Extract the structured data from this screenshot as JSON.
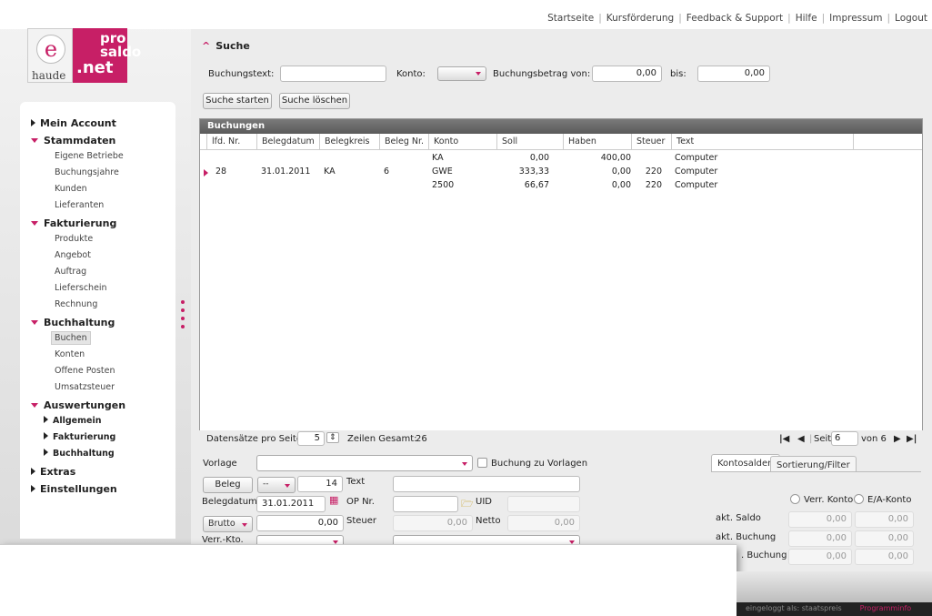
{
  "topnav": {
    "links": [
      "Startseite",
      "Kursförderung",
      "Feedback & Support",
      "Hilfe",
      "Impressum",
      "Logout"
    ]
  },
  "logo": {
    "e_letter": "e",
    "haude": "haude",
    "pro": "pro",
    "saldo": "saldo",
    "net": ".net"
  },
  "sidebar": {
    "mein_account": "Mein Account",
    "stammdaten": "Stammdaten",
    "stammdaten_items": [
      "Eigene Betriebe",
      "Buchungsjahre",
      "Kunden",
      "Lieferanten"
    ],
    "fakturierung": "Fakturierung",
    "fakturierung_items": [
      "Produkte",
      "Angebot",
      "Auftrag",
      "Lieferschein",
      "Rechnung"
    ],
    "buchhaltung": "Buchhaltung",
    "buchhaltung_items": [
      "Buchen",
      "Konten",
      "Offene Posten",
      "Umsatzsteuer"
    ],
    "auswertungen": "Auswertungen",
    "auswertungen_items": [
      "Allgemein",
      "Fakturierung",
      "Buchhaltung"
    ],
    "extras": "Extras",
    "einstellungen": "Einstellungen"
  },
  "search": {
    "title": "Suche",
    "buchungstext_label": "Buchungstext:",
    "buchungstext_value": "",
    "konto_label": "Konto:",
    "betrag_von_label": "Buchungsbetrag von:",
    "betrag_von_value": "0,00",
    "bis_label": "bis:",
    "bis_value": "0,00",
    "start_button": "Suche starten",
    "clear_button": "Suche löschen"
  },
  "grid": {
    "title": "Buchungen",
    "columns": [
      "lfd. Nr.",
      "Belegdatum",
      "Belegkreis",
      "Beleg Nr.",
      "Konto",
      "Soll",
      "Haben",
      "Steuer",
      "Text"
    ],
    "rows": [
      {
        "lfd": "",
        "datum": "",
        "kreis": "",
        "beleg": "",
        "konto": "KA",
        "soll": "0,00",
        "haben": "400,00",
        "steuer": "",
        "text": "Computer"
      },
      {
        "lfd": "28",
        "datum": "31.01.2011",
        "kreis": "KA",
        "beleg": "6",
        "konto": "GWE",
        "soll": "333,33",
        "haben": "0,00",
        "steuer": "220",
        "text": "Computer"
      },
      {
        "lfd": "",
        "datum": "",
        "kreis": "",
        "beleg": "",
        "konto": "2500",
        "soll": "66,67",
        "haben": "0,00",
        "steuer": "220",
        "text": "Computer"
      }
    ],
    "per_page_label": "Datensätze pro Seite:",
    "per_page_value": "5",
    "total_label": "Zeilen Gesamt:",
    "total_value": "26",
    "page_label": "Seite",
    "page_value": "6",
    "of_label": "von 6"
  },
  "form": {
    "vorlage_label": "Vorlage",
    "zu_vorlagen_label": "Buchung zu Vorlagen",
    "beleg_button": "Beleg",
    "beleg_dd": "--",
    "beleg_nr": "14",
    "text_label": "Text",
    "belegdatum_label": "Belegdatum",
    "belegdatum_value": "31.01.2011",
    "op_label": "OP Nr.",
    "uid_label": "UID",
    "brutto_dd": "Brutto",
    "brutto_value": "0,00",
    "steuer_label": "Steuer",
    "steuer_value": "0,00",
    "netto_label": "Netto",
    "netto_value": "0,00",
    "verr_label": "Verr.-Kto."
  },
  "konto_panel": {
    "tab_salden": "Kontosalden",
    "tab_filter": "Sortierung/Filter",
    "radio_verr": "Verr. Konto",
    "radio_ea": "E/A-Konto",
    "akt_saldo": "akt. Saldo",
    "akt_buchung": "akt. Buchung",
    "buchung_partial": ". Buchung",
    "zero": "0,00"
  },
  "status": {
    "logged_in": "eingeloggt als:  staatspreis",
    "programminfo": "Programminfo"
  },
  "colors": {
    "accent": "#c71f66"
  }
}
